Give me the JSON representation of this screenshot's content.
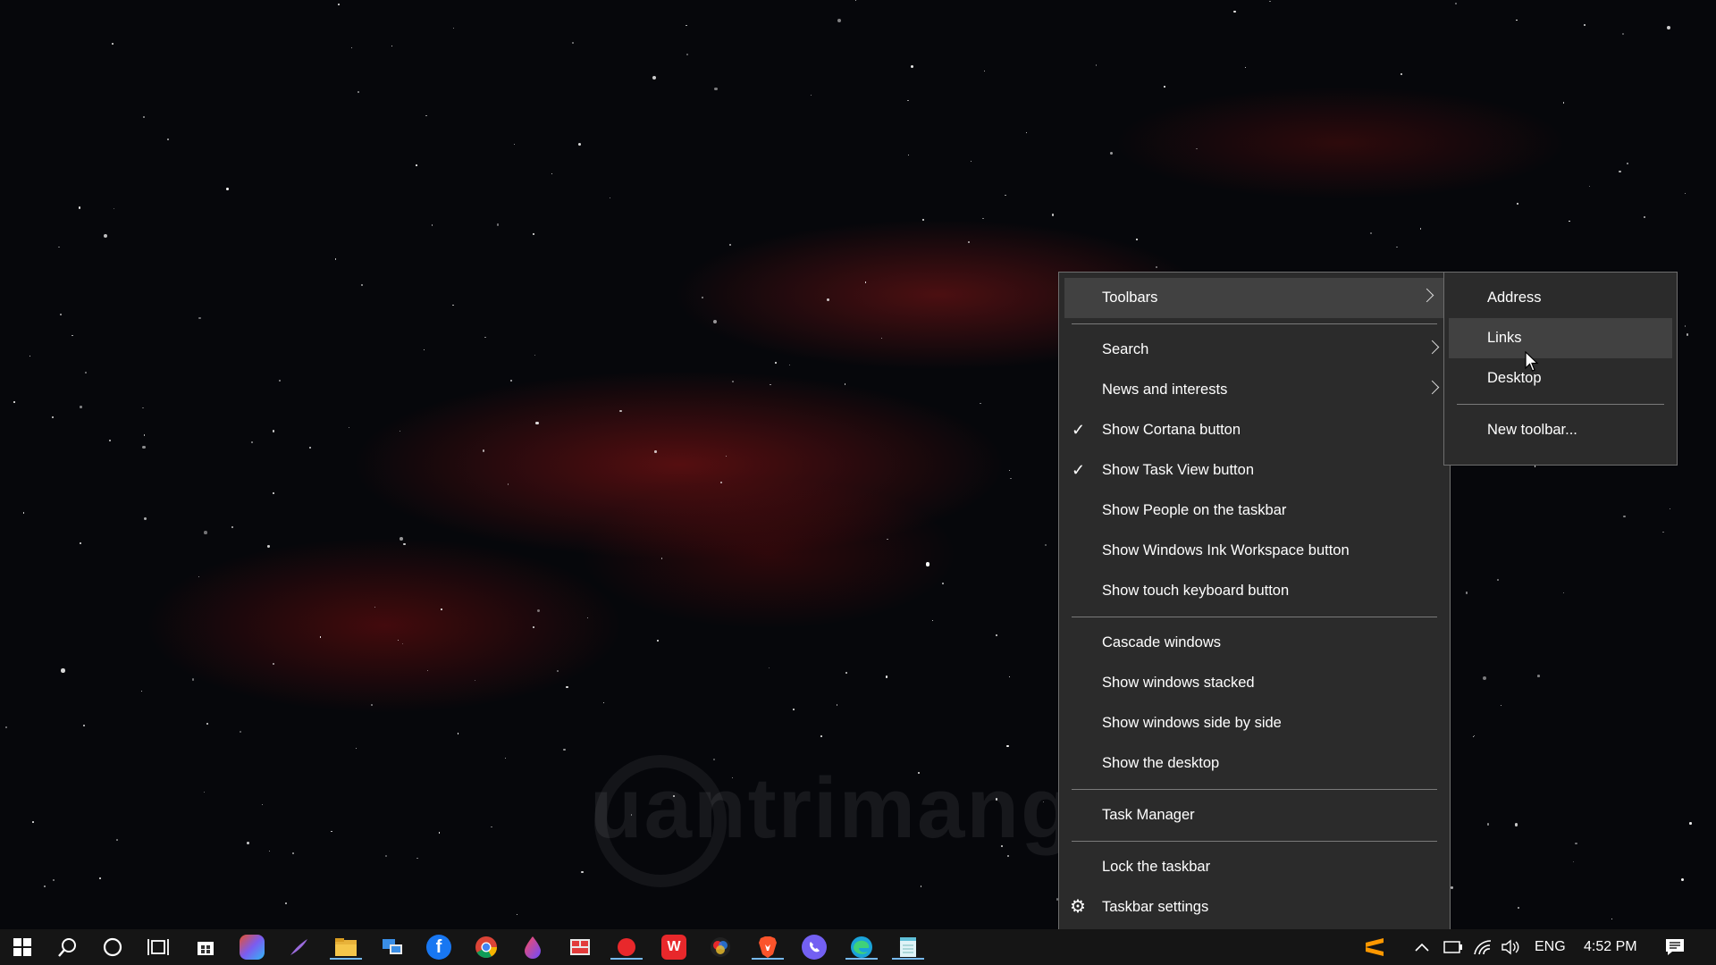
{
  "context_menu": {
    "items": [
      {
        "label": "Toolbars",
        "submenu": true,
        "highlighted": true
      },
      {
        "label": "Search",
        "submenu": true
      },
      {
        "label": "News and interests",
        "submenu": true
      },
      {
        "label": "Show Cortana button",
        "checked": true
      },
      {
        "label": "Show Task View button",
        "checked": true
      },
      {
        "label": "Show People on the taskbar"
      },
      {
        "label": "Show Windows Ink Workspace button"
      },
      {
        "label": "Show touch keyboard button"
      },
      {
        "label": "Cascade windows"
      },
      {
        "label": "Show windows stacked"
      },
      {
        "label": "Show windows side by side"
      },
      {
        "label": "Show the desktop"
      },
      {
        "label": "Task Manager"
      },
      {
        "label": "Lock the taskbar"
      },
      {
        "label": "Taskbar settings",
        "icon": "gear-icon"
      }
    ],
    "check_glyph": "✓"
  },
  "toolbars_submenu": {
    "items": [
      {
        "label": "Address"
      },
      {
        "label": "Links",
        "highlighted": true
      },
      {
        "label": "Desktop"
      },
      {
        "label": "New toolbar..."
      }
    ]
  },
  "taskbar": {
    "apps": [
      "start-icon",
      "search-icon",
      "cortana-icon",
      "task-view-icon",
      "store-icon",
      "office-icon",
      "ink-icon",
      "file-explorer-icon",
      "remote-desktop-icon",
      "facebook-icon",
      "chrome-icon",
      "paint-icon",
      "app-icon",
      "record-icon",
      "wps-icon",
      "color-picker-icon",
      "brave-icon",
      "viber-icon",
      "edge-icon",
      "notepad-icon"
    ],
    "tray": {
      "language": "ENG",
      "time": "4:52 PM"
    }
  },
  "watermark": "uantrimang",
  "colors": {
    "menu_bg": "#2b2b2b",
    "menu_highlight": "#414141",
    "taskbar_bg": "#151515"
  }
}
